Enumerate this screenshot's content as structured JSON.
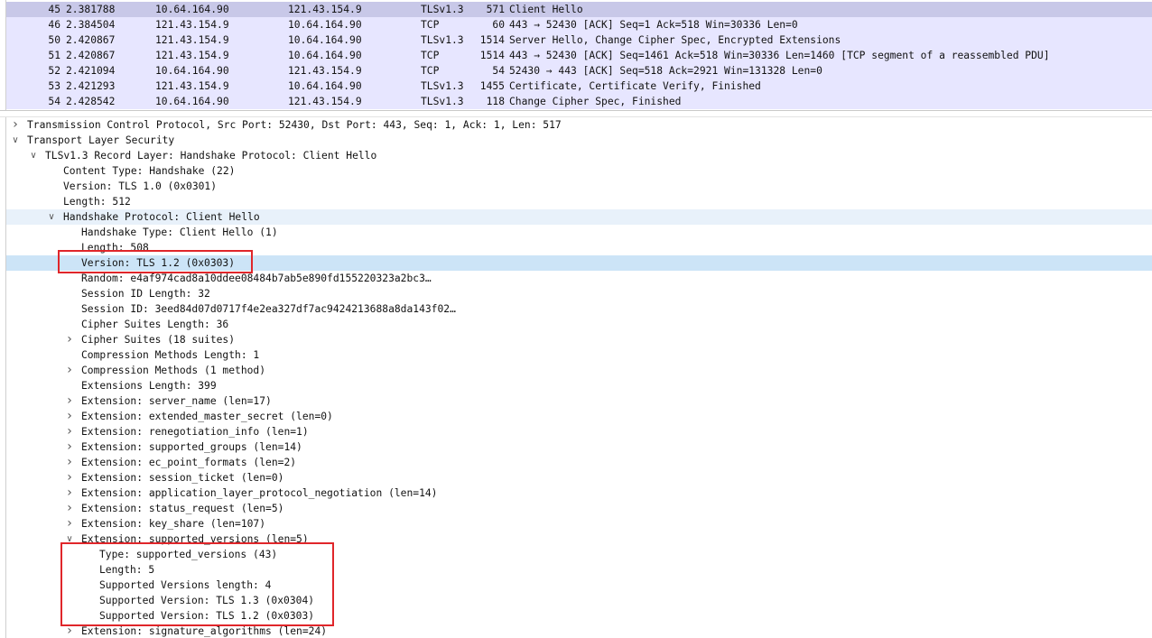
{
  "packet_list": {
    "rows": [
      {
        "no": "45",
        "time": "2.381788",
        "src": "10.64.164.90",
        "dst": "121.43.154.9",
        "proto": "TLSv1.3",
        "len": "571",
        "info": "Client Hello",
        "selected": true
      },
      {
        "no": "46",
        "time": "2.384504",
        "src": "121.43.154.9",
        "dst": "10.64.164.90",
        "proto": "TCP",
        "len": "60",
        "info": "443 → 52430 [ACK] Seq=1 Ack=518 Win=30336 Len=0"
      },
      {
        "no": "50",
        "time": "2.420867",
        "src": "121.43.154.9",
        "dst": "10.64.164.90",
        "proto": "TLSv1.3",
        "len": "1514",
        "info": "Server Hello, Change Cipher Spec, Encrypted Extensions"
      },
      {
        "no": "51",
        "time": "2.420867",
        "src": "121.43.154.9",
        "dst": "10.64.164.90",
        "proto": "TCP",
        "len": "1514",
        "info": "443 → 52430 [ACK] Seq=1461 Ack=518 Win=30336 Len=1460 [TCP segment of a reassembled PDU]"
      },
      {
        "no": "52",
        "time": "2.421094",
        "src": "10.64.164.90",
        "dst": "121.43.154.9",
        "proto": "TCP",
        "len": "54",
        "info": "52430 → 443 [ACK] Seq=518 Ack=2921 Win=131328 Len=0"
      },
      {
        "no": "53",
        "time": "2.421293",
        "src": "121.43.154.9",
        "dst": "10.64.164.90",
        "proto": "TLSv1.3",
        "len": "1455",
        "info": "Certificate, Certificate Verify, Finished"
      },
      {
        "no": "54",
        "time": "2.428542",
        "src": "10.64.164.90",
        "dst": "121.43.154.9",
        "proto": "TLSv1.3",
        "len": "118",
        "info": "Change Cipher Spec, Finished"
      }
    ]
  },
  "details": {
    "rows": [
      {
        "level": 0,
        "expander": "collapsed",
        "text": "Transmission Control Protocol, Src Port: 52430, Dst Port: 443, Seq: 1, Ack: 1, Len: 517"
      },
      {
        "level": 0,
        "expander": "expanded",
        "text": "Transport Layer Security"
      },
      {
        "level": 1,
        "expander": "expanded",
        "text": "TLSv1.3 Record Layer: Handshake Protocol: Client Hello"
      },
      {
        "level": 2,
        "expander": "none",
        "text": "Content Type: Handshake (22)"
      },
      {
        "level": 2,
        "expander": "none",
        "text": "Version: TLS 1.0 (0x0301)"
      },
      {
        "level": 2,
        "expander": "none",
        "text": "Length: 512"
      },
      {
        "level": 2,
        "expander": "expanded",
        "text": "Handshake Protocol: Client Hello",
        "highlight": "light"
      },
      {
        "level": 3,
        "expander": "none",
        "text": "Handshake Type: Client Hello (1)"
      },
      {
        "level": 3,
        "expander": "none",
        "text": "Length: 508"
      },
      {
        "level": 3,
        "expander": "none",
        "text": "Version: TLS 1.2 (0x0303)",
        "highlight": "selected"
      },
      {
        "level": 3,
        "expander": "none",
        "text": "Random: e4af974cad8a10ddee08484b7ab5e890fd155220323a2bc3…"
      },
      {
        "level": 3,
        "expander": "none",
        "text": "Session ID Length: 32"
      },
      {
        "level": 3,
        "expander": "none",
        "text": "Session ID: 3eed84d07d0717f4e2ea327df7ac9424213688a8da143f02…"
      },
      {
        "level": 3,
        "expander": "none",
        "text": "Cipher Suites Length: 36"
      },
      {
        "level": 3,
        "expander": "collapsed",
        "text": "Cipher Suites (18 suites)"
      },
      {
        "level": 3,
        "expander": "none",
        "text": "Compression Methods Length: 1"
      },
      {
        "level": 3,
        "expander": "collapsed",
        "text": "Compression Methods (1 method)"
      },
      {
        "level": 3,
        "expander": "none",
        "text": "Extensions Length: 399"
      },
      {
        "level": 3,
        "expander": "collapsed",
        "text": "Extension: server_name (len=17)"
      },
      {
        "level": 3,
        "expander": "collapsed",
        "text": "Extension: extended_master_secret (len=0)"
      },
      {
        "level": 3,
        "expander": "collapsed",
        "text": "Extension: renegotiation_info (len=1)"
      },
      {
        "level": 3,
        "expander": "collapsed",
        "text": "Extension: supported_groups (len=14)"
      },
      {
        "level": 3,
        "expander": "collapsed",
        "text": "Extension: ec_point_formats (len=2)"
      },
      {
        "level": 3,
        "expander": "collapsed",
        "text": "Extension: session_ticket (len=0)"
      },
      {
        "level": 3,
        "expander": "collapsed",
        "text": "Extension: application_layer_protocol_negotiation (len=14)"
      },
      {
        "level": 3,
        "expander": "collapsed",
        "text": "Extension: status_request (len=5)"
      },
      {
        "level": 3,
        "expander": "collapsed",
        "text": "Extension: key_share (len=107)"
      },
      {
        "level": 3,
        "expander": "expanded",
        "text": "Extension: supported_versions (len=5)"
      },
      {
        "level": 4,
        "expander": "none",
        "text": "Type: supported_versions (43)"
      },
      {
        "level": 4,
        "expander": "none",
        "text": "Length: 5"
      },
      {
        "level": 4,
        "expander": "none",
        "text": "Supported Versions length: 4"
      },
      {
        "level": 4,
        "expander": "none",
        "text": "Supported Version: TLS 1.3 (0x0304)"
      },
      {
        "level": 4,
        "expander": "none",
        "text": "Supported Version: TLS 1.2 (0x0303)"
      },
      {
        "level": 3,
        "expander": "collapsed",
        "text": "Extension: signature_algorithms (len=24)"
      }
    ]
  },
  "annotations": {
    "color": "#e0262a"
  }
}
